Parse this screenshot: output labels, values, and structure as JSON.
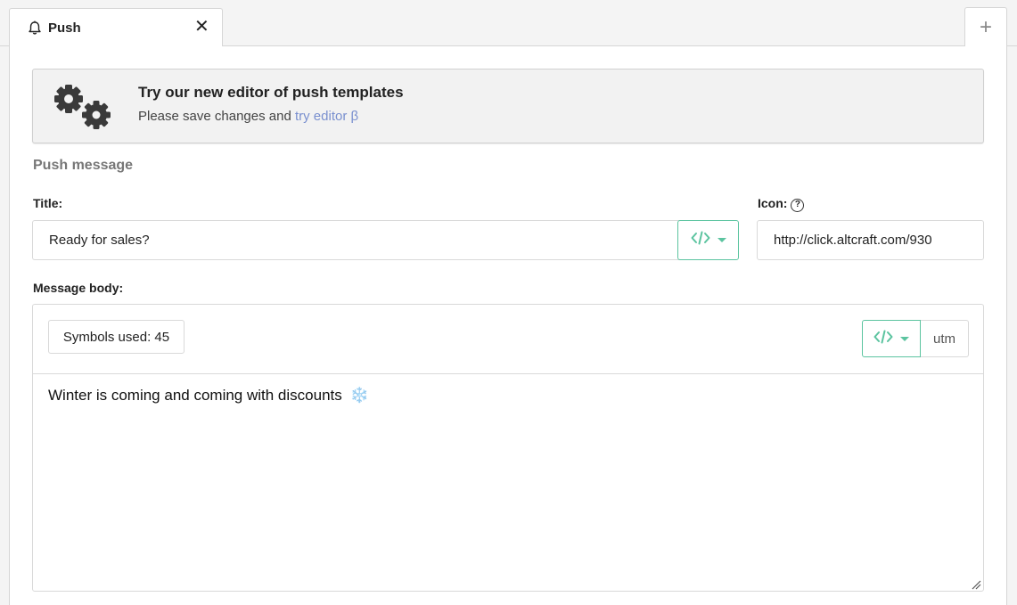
{
  "tabs": {
    "active_label": "Push",
    "close_symbol": "✕",
    "add_symbol": "+"
  },
  "banner": {
    "title": "Try our new editor of push templates",
    "text": "Please save changes and ",
    "link": "try editor β",
    "link_color": "#7a90cf",
    "icon": "gears-icon"
  },
  "section": {
    "title": "Push message"
  },
  "title_field": {
    "label": "Title:",
    "value": "Ready for sales?"
  },
  "icon_field": {
    "label": "Icon:",
    "help_symbol": "?",
    "value": "http://click.altcraft.com/930"
  },
  "message_body": {
    "label": "Message body:",
    "symbols_used": "Symbols used: 45",
    "utm_label": "utm",
    "text": "Winter is coming and coming with discounts",
    "emoji": "❄️"
  },
  "colors": {
    "accent": "#5cc4a0",
    "link": "#7a90cf",
    "border": "#d9d9d9"
  }
}
